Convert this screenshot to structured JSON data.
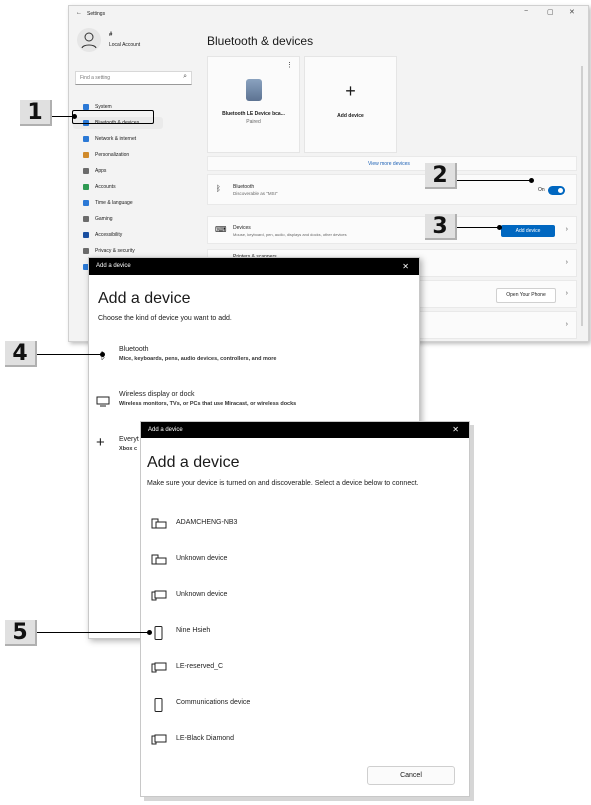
{
  "settings": {
    "back_icon": "back-arrow-icon",
    "title": "Settings",
    "window_controls": {
      "minimize": "−",
      "maximize": "▢",
      "close": "✕"
    },
    "user": {
      "name": "#",
      "account": "Local Account"
    },
    "search_placeholder": "Find a setting",
    "nav": [
      {
        "label": "System",
        "color": "#2b79d6"
      },
      {
        "label": "Bluetooth & devices",
        "color": "#2b79d6"
      },
      {
        "label": "Network & internet",
        "color": "#2b79d6"
      },
      {
        "label": "Personalization",
        "color": "#d08a2b"
      },
      {
        "label": "Apps",
        "color": "#6b6b6b"
      },
      {
        "label": "Accounts",
        "color": "#2e9a52"
      },
      {
        "label": "Time & language",
        "color": "#2b79d6"
      },
      {
        "label": "Gaming",
        "color": "#6b6b6b"
      },
      {
        "label": "Accessibility",
        "color": "#1a4fa0"
      },
      {
        "label": "Privacy & security",
        "color": "#6b6b6b"
      },
      {
        "label": "Windows Update",
        "color": "#2b79d6"
      }
    ],
    "page_title": "Bluetooth & devices",
    "device_card": {
      "name": "Bluetooth LE Device bca...",
      "status": "Paired",
      "menu": "⋮"
    },
    "add_card": {
      "plus": "+",
      "label": "Add device"
    },
    "view_more": "View more devices",
    "bluetooth_row": {
      "title": "Bluetooth",
      "subtitle": "Discoverable as \"MSI\"",
      "toggle_label": "On"
    },
    "devices_row": {
      "title": "Devices",
      "subtitle": "Mouse, keyboard, pen, audio, displays and docks, other devices",
      "button": "Add device"
    },
    "row_printers": {
      "title": "Printers & scanners"
    },
    "phone_row": {
      "button": "Open Your Phone"
    },
    "chevron": "›"
  },
  "callouts": [
    "1",
    "2",
    "3",
    "4",
    "5"
  ],
  "dialog1": {
    "bar_title": "Add a device",
    "close": "✕",
    "heading": "Add a device",
    "subheading": "Choose the kind of device you want to add.",
    "options": [
      {
        "title": "Bluetooth",
        "sub": "Mice, keyboards, pens, audio devices, controllers, and more",
        "icon": "bluetooth-icon"
      },
      {
        "title": "Wireless display or dock",
        "sub": "Wireless monitors, TVs, or PCs that use Miracast, or wireless docks",
        "icon": "monitor-icon"
      },
      {
        "title": "Everyt",
        "sub": "Xbox c",
        "icon": "plus-icon"
      }
    ]
  },
  "dialog2": {
    "bar_title": "Add a device",
    "close": "✕",
    "heading": "Add a device",
    "instructions": "Make sure your device is turned on and discoverable. Select a device below to connect.",
    "devices": [
      {
        "name": "ADAMCHENG-NB3",
        "icon": "computer-icon"
      },
      {
        "name": "Unknown device",
        "icon": "computer-icon"
      },
      {
        "name": "Unknown device",
        "icon": "display-icon"
      },
      {
        "name": "Nine Hsieh",
        "icon": "phone-icon"
      },
      {
        "name": "LE-reserved_C",
        "icon": "display-icon"
      },
      {
        "name": "Communications device",
        "icon": "phone-icon"
      },
      {
        "name": "LE-Black Diamond",
        "icon": "display-icon"
      }
    ],
    "cancel": "Cancel"
  }
}
